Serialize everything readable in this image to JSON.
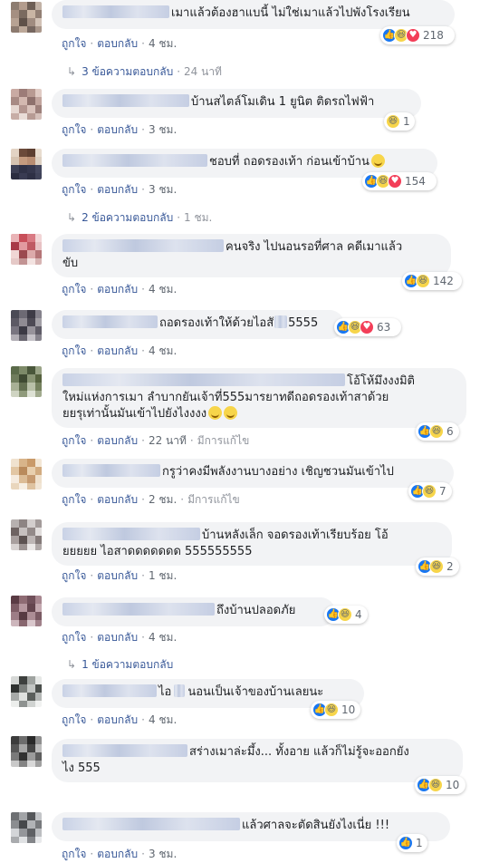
{
  "labels": {
    "like": "ถูกใจ",
    "reply": "ตอบกลับ",
    "edited": "มีการแก้ไข"
  },
  "comments": [
    {
      "text": "เมาแล้วต้องฮาแบนี้ ไม่ใช่เมาแล้วไปพังโรงเรียน",
      "time": "4 ชม.",
      "count": "218",
      "replies": {
        "label": "3 ข้อความตอบกลับ",
        "time": "24 นาที"
      }
    },
    {
      "text": "บ้านสไตล์โมเดิน 1 ยูนิต ติดรถไฟฟ้า",
      "time": "3 ชม.",
      "count": "1"
    },
    {
      "text": "ชอบที่ ถอดรองเท้า ก่อนเข้าบ้าน",
      "time": "3 ชม.",
      "count": "154",
      "replies": {
        "label": "2 ข้อความตอบกลับ",
        "time": "1 ชม."
      }
    },
    {
      "text1": "คนจริง ไปนอนรอที่ศาล คดีเมาแล้ว",
      "text2": "ขับ",
      "time": "4 ชม.",
      "count": "142"
    },
    {
      "text": "ถอดรองเท้าให้ด้วยไอสั",
      "text_b": "5555",
      "time": "4 ชม.",
      "count": "63"
    },
    {
      "text1": "โอ้โห้มึงงงมิติ",
      "text2": "ใหม่แห่งการเมา ลำบากยันเจ้าที่555มารยาทดีถอดรองเท้าสาด้วย",
      "text3": "ยยรุเท่านั้นมันเข้าไปยังไงงงง",
      "time": "22 นาที",
      "count": "6"
    },
    {
      "text": "กรูว่าคงมีพลังงานบางอย่าง เชิญชวนมันเข้าไป",
      "time": "2 ชม.",
      "count": "7"
    },
    {
      "text1": "บ้านหลังเล็ก จอดรองเท้าเรียบร้อย โอ้",
      "text2": "ยยยยย ไอสาดดดดดดด 555555555",
      "time": "1 ชม.",
      "count": "2"
    },
    {
      "text": "ถึงบ้านปลอดภัย",
      "time": "4 ชม.",
      "count": "4",
      "replies": {
        "label": "1 ข้อความตอบกลับ"
      }
    },
    {
      "text_a": "ไอ",
      "text": "นอนเป็นเจ้าของบ้านเลยนะ",
      "time": "4 ชม.",
      "count": "10"
    },
    {
      "text1": "สร่างเมาล่ะมึ้ง... ทั้งอาย แล้วก็ไม่รู้จะออกยัง",
      "text2": "ไง 555",
      "time": "3 ชม.",
      "count": "10"
    },
    {
      "text": "แล้วศาลจะตัดสินยังไงเนี่ย !!!",
      "time": "3 ชม.",
      "count": "1"
    }
  ],
  "colors": {
    "link": "#385898",
    "bubble": "#f2f3f5",
    "like": "#1877f2",
    "haha": "#f7d54a",
    "love": "#f33e58"
  }
}
